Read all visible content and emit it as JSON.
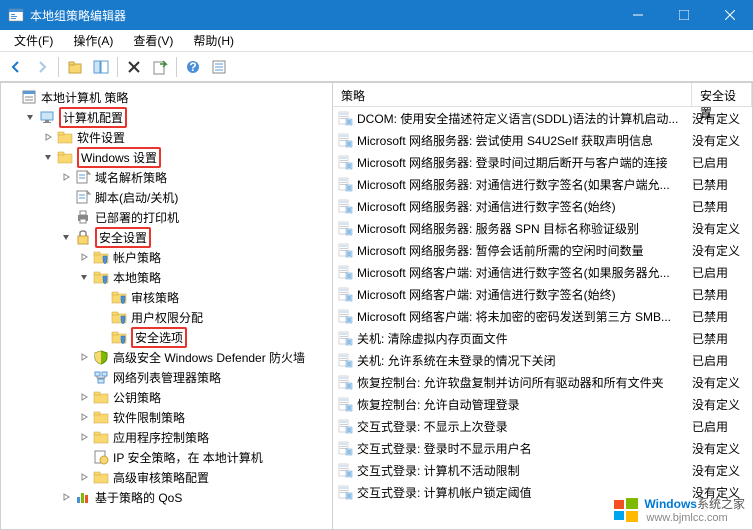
{
  "title": "本地组策略编辑器",
  "menubar": {
    "file": "文件(F)",
    "action": "操作(A)",
    "view": "查看(V)",
    "help": "帮助(H)"
  },
  "tree": {
    "root": "本地计算机 策略",
    "computer_config": "计算机配置",
    "software_settings": "软件设置",
    "windows_settings": "Windows 设置",
    "dns_policy": "域名解析策略",
    "scripts": "脚本(启动/关机)",
    "deployed_printers": "已部署的打印机",
    "security_settings": "安全设置",
    "account_policies": "帐户策略",
    "local_policies": "本地策略",
    "audit_policy": "审核策略",
    "user_rights": "用户权限分配",
    "security_options": "安全选项",
    "defender_firewall": "高级安全 Windows Defender 防火墙",
    "network_list": "网络列表管理器策略",
    "public_key": "公钥策略",
    "software_restriction": "软件限制策略",
    "app_control": "应用程序控制策略",
    "ip_security": "IP 安全策略，在 本地计算机",
    "advanced_audit": "高级审核策略配置",
    "qos": "基于策略的 QoS"
  },
  "list": {
    "header_policy": "策略",
    "header_setting": "安全设置",
    "rows": [
      {
        "name": "DCOM: 使用安全描述符定义语言(SDDL)语法的计算机启动...",
        "setting": "没有定义"
      },
      {
        "name": "Microsoft 网络服务器: 尝试使用 S4U2Self 获取声明信息",
        "setting": "没有定义"
      },
      {
        "name": "Microsoft 网络服务器: 登录时间过期后断开与客户端的连接",
        "setting": "已启用"
      },
      {
        "name": "Microsoft 网络服务器: 对通信进行数字签名(如果客户端允...",
        "setting": "已禁用"
      },
      {
        "name": "Microsoft 网络服务器: 对通信进行数字签名(始终)",
        "setting": "已禁用"
      },
      {
        "name": "Microsoft 网络服务器: 服务器 SPN 目标名称验证级别",
        "setting": "没有定义"
      },
      {
        "name": "Microsoft 网络服务器: 暂停会话前所需的空闲时间数量",
        "setting": "没有定义"
      },
      {
        "name": "Microsoft 网络客户端: 对通信进行数字签名(如果服务器允...",
        "setting": "已启用"
      },
      {
        "name": "Microsoft 网络客户端: 对通信进行数字签名(始终)",
        "setting": "已禁用"
      },
      {
        "name": "Microsoft 网络客户端: 将未加密的密码发送到第三方 SMB...",
        "setting": "已禁用"
      },
      {
        "name": "关机: 清除虚拟内存页面文件",
        "setting": "已禁用"
      },
      {
        "name": "关机: 允许系统在未登录的情况下关闭",
        "setting": "已启用"
      },
      {
        "name": "恢复控制台: 允许软盘复制并访问所有驱动器和所有文件夹",
        "setting": "没有定义"
      },
      {
        "name": "恢复控制台: 允许自动管理登录",
        "setting": "没有定义"
      },
      {
        "name": "交互式登录: 不显示上次登录",
        "setting": "已启用"
      },
      {
        "name": "交互式登录: 登录时不显示用户名",
        "setting": "没有定义"
      },
      {
        "name": "交互式登录: 计算机不活动限制",
        "setting": "没有定义"
      },
      {
        "name": "交互式登录: 计算机帐户锁定阈值",
        "setting": "没有定义"
      }
    ]
  },
  "watermark": {
    "w1": "Windows",
    "w2": "系统之家",
    "url": "www.bjmlcc.com"
  }
}
